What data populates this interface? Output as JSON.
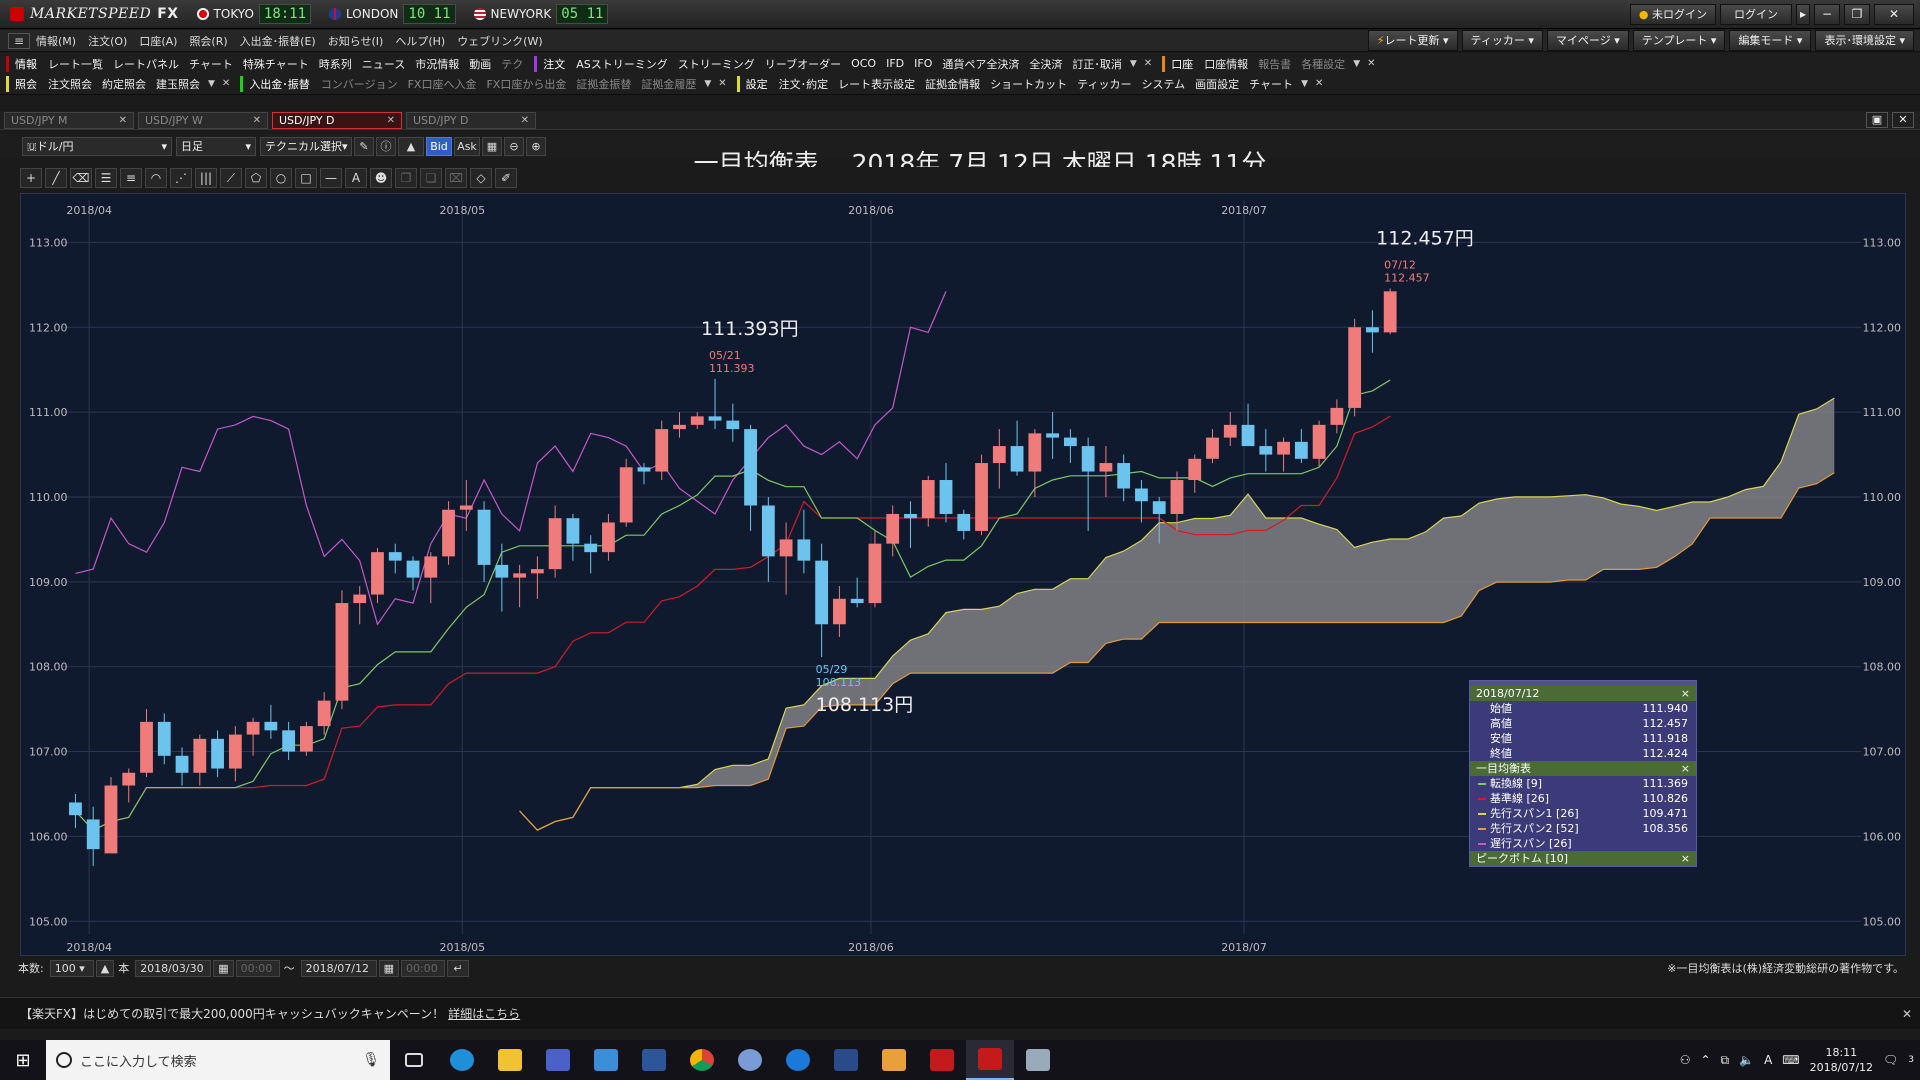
{
  "app": {
    "brand_italic": "MARKETSPEED",
    "brand_bold": "FX",
    "clocks": [
      {
        "city": "TOKYO",
        "time": "18:11"
      },
      {
        "city": "LONDON",
        "time": "10 11"
      },
      {
        "city": "NEWYORK",
        "time": "05 11"
      }
    ],
    "login_status": "未ログイン",
    "login_button": "ログイン"
  },
  "menu": [
    "情報(M)",
    "注文(O)",
    "口座(A)",
    "照会(R)",
    "入出金･振替(E)",
    "お知らせ(I)",
    "ヘルプ(H)",
    "ウェブリンク(W)"
  ],
  "toolbar_right": [
    "レート更新",
    "ティッカー",
    "マイページ",
    "テンプレート",
    "編集モード",
    "表示･環境設定"
  ],
  "toolbar1": {
    "group1_label": "情報",
    "group1": [
      "レート一覧",
      "レートパネル",
      "チャート",
      "特殊チャート",
      "時系列",
      "ニュース",
      "市況情報",
      "動画",
      "テク"
    ],
    "group2_label": "注文",
    "group2": [
      "ASストリーミング",
      "ストリーミング",
      "リーブオーダー",
      "OCO",
      "IFD",
      "IFO",
      "通貨ペア全決済",
      "全決済",
      "訂正･取消"
    ],
    "group3_label": "口座",
    "group3": [
      "口座情報"
    ],
    "group3_dim": [
      "報告書",
      "各種設定"
    ]
  },
  "toolbar2": {
    "group1_label": "照会",
    "group1": [
      "注文照会",
      "約定照会",
      "建玉照会"
    ],
    "group2_label": "入出金･振替",
    "group2_dim": [
      "コンバージョン",
      "FX口座へ入金",
      "FX口座から出金",
      "証拠金振替",
      "証拠金履歴"
    ],
    "group3_label": "設定",
    "group3": [
      "注文･約定",
      "レート表示設定",
      "証拠金情報",
      "ショートカット",
      "ティッカー",
      "システム",
      "画面設定",
      "チャート"
    ]
  },
  "tabs": [
    {
      "label": "USD/JPY M",
      "active": false
    },
    {
      "label": "USD/JPY W",
      "active": false
    },
    {
      "label": "USD/JPY D",
      "active": true
    },
    {
      "label": "USD/JPY D",
      "active": false
    }
  ],
  "chart_toolbar": {
    "pair": "ドル/円",
    "period": "日足",
    "technical": "テクニカル選択",
    "bid": "Bid",
    "ask": "Ask"
  },
  "chart_title": "一目均衡表　 2018年 7月 12日 木曜日 18時 11分",
  "chart_data": {
    "type": "candlestick",
    "title": "一目均衡表",
    "x_labels": [
      "2018/04",
      "2018/05",
      "2018/06",
      "2018/07"
    ],
    "y_ticks": [
      "113.00",
      "112.00",
      "111.00",
      "110.00",
      "109.00",
      "108.00",
      "107.00",
      "106.00",
      "105.00"
    ],
    "ylim": [
      104.85,
      113.5
    ],
    "dates": [
      "2018/03/30",
      "2018/04/02",
      "2018/04/03",
      "2018/04/04",
      "2018/04/05",
      "2018/04/06",
      "2018/04/09",
      "2018/04/10",
      "2018/04/11",
      "2018/04/12",
      "2018/04/13",
      "2018/04/16",
      "2018/04/17",
      "2018/04/18",
      "2018/04/19",
      "2018/04/20",
      "2018/04/23",
      "2018/04/24",
      "2018/04/25",
      "2018/04/26",
      "2018/04/27",
      "2018/04/30",
      "2018/05/01",
      "2018/05/02",
      "2018/05/03",
      "2018/05/04",
      "2018/05/07",
      "2018/05/08",
      "2018/05/09",
      "2018/05/10",
      "2018/05/11",
      "2018/05/14",
      "2018/05/15",
      "2018/05/16",
      "2018/05/17",
      "2018/05/18",
      "2018/05/21",
      "2018/05/22",
      "2018/05/23",
      "2018/05/24",
      "2018/05/25",
      "2018/05/28",
      "2018/05/29",
      "2018/05/30",
      "2018/05/31",
      "2018/06/01",
      "2018/06/04",
      "2018/06/05",
      "2018/06/06",
      "2018/06/07",
      "2018/06/08",
      "2018/06/11",
      "2018/06/12",
      "2018/06/13",
      "2018/06/14",
      "2018/06/15",
      "2018/06/18",
      "2018/06/19",
      "2018/06/20",
      "2018/06/21",
      "2018/06/22",
      "2018/06/25",
      "2018/06/26",
      "2018/06/27",
      "2018/06/28",
      "2018/06/29",
      "2018/07/02",
      "2018/07/03",
      "2018/07/04",
      "2018/07/05",
      "2018/07/06",
      "2018/07/09",
      "2018/07/10",
      "2018/07/11",
      "2018/07/12"
    ],
    "ohlc": [
      [
        106.4,
        106.5,
        106.1,
        106.25
      ],
      [
        106.2,
        106.35,
        105.65,
        105.85
      ],
      [
        105.8,
        106.7,
        105.8,
        106.6
      ],
      [
        106.6,
        106.8,
        106.4,
        106.75
      ],
      [
        106.75,
        107.5,
        106.7,
        107.35
      ],
      [
        107.35,
        107.45,
        106.85,
        106.95
      ],
      [
        106.95,
        107.05,
        106.6,
        106.75
      ],
      [
        106.75,
        107.2,
        106.6,
        107.15
      ],
      [
        107.15,
        107.25,
        106.7,
        106.8
      ],
      [
        106.8,
        107.3,
        106.65,
        107.2
      ],
      [
        107.2,
        107.4,
        106.95,
        107.35
      ],
      [
        107.35,
        107.55,
        107.15,
        107.25
      ],
      [
        107.25,
        107.35,
        106.9,
        107.0
      ],
      [
        107.0,
        107.35,
        106.95,
        107.3
      ],
      [
        107.3,
        107.7,
        107.2,
        107.6
      ],
      [
        107.6,
        108.9,
        107.5,
        108.75
      ],
      [
        108.75,
        108.95,
        108.5,
        108.85
      ],
      [
        108.85,
        109.4,
        108.75,
        109.35
      ],
      [
        109.35,
        109.45,
        109.1,
        109.25
      ],
      [
        109.25,
        109.3,
        108.9,
        109.05
      ],
      [
        109.05,
        109.35,
        108.75,
        109.3
      ],
      [
        109.3,
        109.95,
        109.2,
        109.85
      ],
      [
        109.85,
        110.2,
        109.6,
        109.9
      ],
      [
        109.85,
        109.95,
        109.0,
        109.2
      ],
      [
        109.2,
        109.45,
        108.65,
        109.05
      ],
      [
        109.05,
        109.2,
        108.7,
        109.1
      ],
      [
        109.1,
        109.3,
        108.8,
        109.15
      ],
      [
        109.15,
        109.9,
        109.05,
        109.75
      ],
      [
        109.75,
        109.8,
        109.25,
        109.45
      ],
      [
        109.45,
        109.55,
        109.1,
        109.35
      ],
      [
        109.35,
        109.8,
        109.25,
        109.7
      ],
      [
        109.7,
        110.45,
        109.65,
        110.35
      ],
      [
        110.35,
        110.4,
        110.15,
        110.3
      ],
      [
        110.3,
        110.9,
        110.2,
        110.8
      ],
      [
        110.8,
        111.0,
        110.7,
        110.85
      ],
      [
        110.85,
        111.0,
        110.8,
        110.95
      ],
      [
        110.95,
        111.393,
        110.8,
        110.9
      ],
      [
        110.9,
        111.1,
        110.65,
        110.8
      ],
      [
        110.8,
        110.85,
        109.6,
        109.9
      ],
      [
        109.9,
        110.0,
        109.0,
        109.3
      ],
      [
        109.3,
        109.7,
        108.85,
        109.5
      ],
      [
        109.5,
        109.85,
        109.1,
        109.25
      ],
      [
        109.25,
        109.45,
        108.113,
        108.5
      ],
      [
        108.5,
        108.95,
        108.35,
        108.8
      ],
      [
        108.8,
        109.05,
        108.7,
        108.75
      ],
      [
        108.75,
        109.6,
        108.7,
        109.45
      ],
      [
        109.45,
        109.9,
        109.3,
        109.8
      ],
      [
        109.8,
        109.95,
        109.4,
        109.75
      ],
      [
        109.75,
        110.25,
        109.65,
        110.2
      ],
      [
        110.2,
        110.4,
        109.7,
        109.8
      ],
      [
        109.8,
        109.85,
        109.5,
        109.6
      ],
      [
        109.6,
        110.5,
        109.55,
        110.4
      ],
      [
        110.4,
        110.8,
        110.1,
        110.6
      ],
      [
        110.6,
        110.9,
        110.25,
        110.3
      ],
      [
        110.3,
        110.8,
        110.0,
        110.75
      ],
      [
        110.75,
        111.0,
        110.45,
        110.7
      ],
      [
        110.7,
        110.8,
        110.4,
        110.6
      ],
      [
        110.6,
        110.7,
        109.6,
        110.3
      ],
      [
        110.3,
        110.6,
        110.0,
        110.4
      ],
      [
        110.4,
        110.5,
        109.95,
        110.1
      ],
      [
        110.1,
        110.2,
        109.7,
        109.95
      ],
      [
        109.95,
        110.0,
        109.45,
        109.8
      ],
      [
        109.8,
        110.3,
        109.6,
        110.2
      ],
      [
        110.2,
        110.5,
        110.05,
        110.45
      ],
      [
        110.45,
        110.8,
        110.4,
        110.7
      ],
      [
        110.7,
        111.0,
        110.6,
        110.85
      ],
      [
        110.85,
        111.1,
        110.6,
        110.6
      ],
      [
        110.6,
        110.8,
        110.3,
        110.5
      ],
      [
        110.5,
        110.7,
        110.3,
        110.65
      ],
      [
        110.65,
        110.8,
        110.4,
        110.45
      ],
      [
        110.45,
        110.9,
        110.35,
        110.85
      ],
      [
        110.85,
        111.15,
        110.75,
        111.05
      ],
      [
        111.05,
        112.1,
        110.95,
        112.0
      ],
      [
        112.0,
        112.2,
        111.7,
        111.94
      ],
      [
        111.94,
        112.457,
        111.918,
        112.424
      ]
    ],
    "future_days": 26,
    "peaks": [
      {
        "label": "111.393円",
        "date": "05/21",
        "value": "111.393",
        "kind": "high"
      },
      {
        "label": "108.113円",
        "date": "05/29",
        "value": "108.113",
        "kind": "low"
      },
      {
        "label": "112.457円",
        "date": "07/12",
        "value": "112.457",
        "kind": "high"
      }
    ],
    "line_colors": {
      "tenkan": "#7ec86a",
      "kijun": "#d11c2b",
      "span1": "#d8d35a",
      "span2": "#e09a3c",
      "chikou": "#c259c9",
      "cloud": "#8a8a8a",
      "up": "#f07b7b",
      "down": "#6cc4ee"
    }
  },
  "info_panel": {
    "date": "2018/07/12",
    "ohlc_rows": [
      {
        "name": "始値",
        "value": "111.940"
      },
      {
        "name": "高値",
        "value": "112.457"
      },
      {
        "name": "安値",
        "value": "111.918"
      },
      {
        "name": "終値",
        "value": "112.424"
      }
    ],
    "ichimoku_title": "一目均衡表",
    "ichimoku_rows": [
      {
        "name": "転換線 [9]",
        "value": "111.369",
        "color": "#7ec86a"
      },
      {
        "name": "基準線 [26]",
        "value": "110.826",
        "color": "#d11c2b"
      },
      {
        "name": "先行スパン1 [26]",
        "value": "109.471",
        "color": "#d8d35a"
      },
      {
        "name": "先行スパン2 [52]",
        "value": "108.356",
        "color": "#e09a3c"
      },
      {
        "name": "遅行スパン [26]",
        "value": "",
        "color": "#c259c9"
      }
    ],
    "peak_title": "ピークボトム [10]",
    "close": "×"
  },
  "bottom": {
    "count_label": "本数:",
    "count_value": "100",
    "unit": "本",
    "from_date": "2018/03/30",
    "from_time": "00:00",
    "tilde": "〜",
    "to_date": "2018/07/12",
    "to_time": "00:00",
    "copyright": "※一目均衡表は(株)経済変動総研の著作物です。"
  },
  "banner": {
    "text": "【楽天FX】はじめての取引で最大200,000円キャッシュバックキャンペーン！",
    "link": "詳細はこちら"
  },
  "taskbar": {
    "search_placeholder": "ここに入力して検索",
    "time": "18:11",
    "date": "2018/07/12",
    "notif_count": "3",
    "ime": "A"
  }
}
